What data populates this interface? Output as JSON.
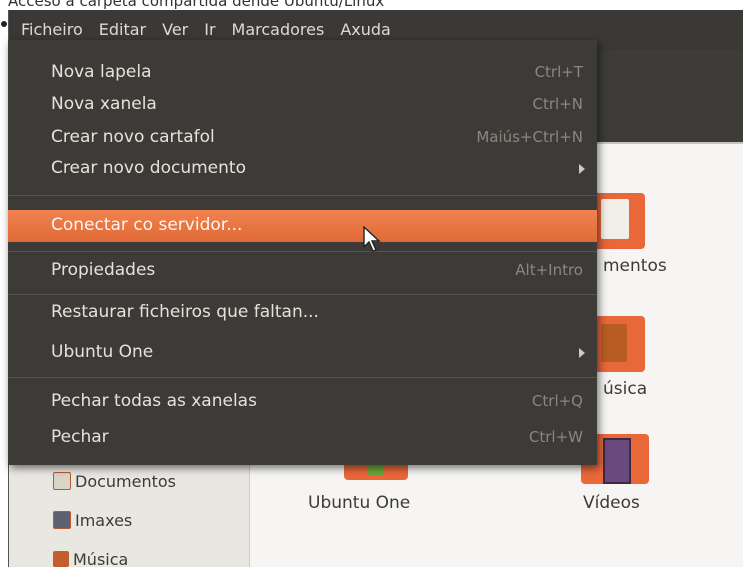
{
  "caption": "Acceso á carpeta compartida dende Ubuntu/Linux",
  "menubar": [
    "Ficheiro",
    "Editar",
    "Ver",
    "Ir",
    "Marcadores",
    "Axuda"
  ],
  "menu": {
    "nova_lapela": {
      "label": "Nova lapela",
      "shortcut": "Ctrl+T"
    },
    "nova_xanela": {
      "label": "Nova xanela",
      "shortcut": "Ctrl+N"
    },
    "crear_cartafol": {
      "label": "Crear novo cartafol",
      "shortcut": "Maiús+Ctrl+N"
    },
    "crear_documento": {
      "label": "Crear novo documento"
    },
    "conectar": {
      "label": "Conectar co servidor..."
    },
    "propiedades": {
      "label": "Propiedades",
      "shortcut": "Alt+Intro"
    },
    "restaurar": {
      "label": "Restaurar ficheiros que faltan..."
    },
    "ubuntu_one": {
      "label": "Ubuntu One"
    },
    "pechar_todas": {
      "label": "Pechar todas as xanelas",
      "shortcut": "Ctrl+Q"
    },
    "pechar": {
      "label": "Pechar",
      "shortcut": "Ctrl+W"
    }
  },
  "sidebar": [
    "Documentos",
    "Imaxes",
    "Música"
  ],
  "content": {
    "documentos_partial": "mentos",
    "musica_partial": "úsica",
    "ubuntu_one": "Ubuntu One",
    "videos": "Vídeos"
  },
  "colors": {
    "highlight": "#e8743f",
    "menu_bg": "#3c3b37",
    "accent_orange": "#e9683a"
  }
}
